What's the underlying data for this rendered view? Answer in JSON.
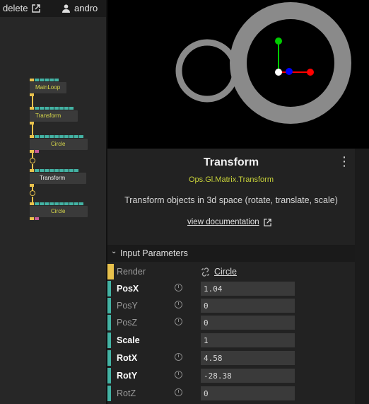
{
  "topbar": {
    "delete_label": "delete",
    "user_name": "andro"
  },
  "patch": {
    "ops": [
      {
        "label": "MainLoop"
      },
      {
        "label": "Transform"
      },
      {
        "label": "Circle"
      },
      {
        "label": "Transform"
      },
      {
        "label": "Circle"
      }
    ]
  },
  "inspector": {
    "title": "Transform",
    "namespace": "Ops.Gl.Matrix.Transform",
    "description": "Transform objects in 3d space (rotate, translate, scale)",
    "doc_link": "view documentation",
    "section_title": "Input Parameters",
    "params": [
      {
        "name": "Render",
        "value": "Circle"
      },
      {
        "name": "PosX",
        "value": "1.04"
      },
      {
        "name": "PosY",
        "value": "0"
      },
      {
        "name": "PosZ",
        "value": "0"
      },
      {
        "name": "Scale",
        "value": "1"
      },
      {
        "name": "RotX",
        "value": "4.58"
      },
      {
        "name": "RotY",
        "value": "-28.38"
      },
      {
        "name": "RotZ",
        "value": "0"
      }
    ]
  },
  "colors": {
    "accent_teal": "#43b3a4",
    "accent_yellow": "#e8c14c",
    "namespace_yellow": "#c8d23a",
    "gizmo_x": "#ff0000",
    "gizmo_y": "#00cc00",
    "gizmo_z": "#0000ff"
  }
}
